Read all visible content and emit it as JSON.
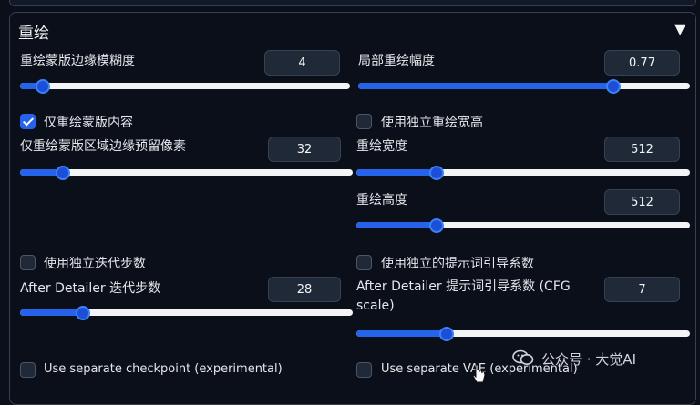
{
  "section": {
    "title": "重绘",
    "collapse_icon": "triangle-down-icon"
  },
  "controls": {
    "mask_blur": {
      "label": "重绘蒙版边缘模糊度",
      "value": "4",
      "fraction": 0.07
    },
    "denoise": {
      "label": "局部重绘幅度",
      "value": "0.77",
      "fraction": 0.77
    },
    "inpaint_only_masked": {
      "label": "仅重绘蒙版内容",
      "checked": true
    },
    "use_sep_wh": {
      "label": "使用独立重绘宽高",
      "checked": false
    },
    "padding": {
      "label": "仅重绘蒙版区域边缘预留像素",
      "value": "32",
      "fraction": 0.13
    },
    "width": {
      "label": "重绘宽度",
      "value": "512",
      "fraction": 0.24
    },
    "height": {
      "label": "重绘高度",
      "value": "512",
      "fraction": 0.24
    },
    "use_sep_steps": {
      "label": "使用独立迭代步数",
      "checked": false
    },
    "use_sep_cfg": {
      "label": "使用独立的提示词引导系数",
      "checked": false
    },
    "steps": {
      "label": "After Detailer 迭代步数",
      "value": "28",
      "fraction": 0.19
    },
    "cfg": {
      "label": "After Detailer 提示词引导系数 (CFG scale)",
      "value": "7",
      "fraction": 0.27
    },
    "use_sep_ckpt": {
      "label": "Use separate checkpoint (experimental)",
      "checked": false
    },
    "use_sep_vae": {
      "label": "Use separate VAE (experimental)",
      "checked": false
    }
  },
  "watermark": {
    "text": "公众号 · 大觉AI",
    "icon": "wechat-icon"
  }
}
